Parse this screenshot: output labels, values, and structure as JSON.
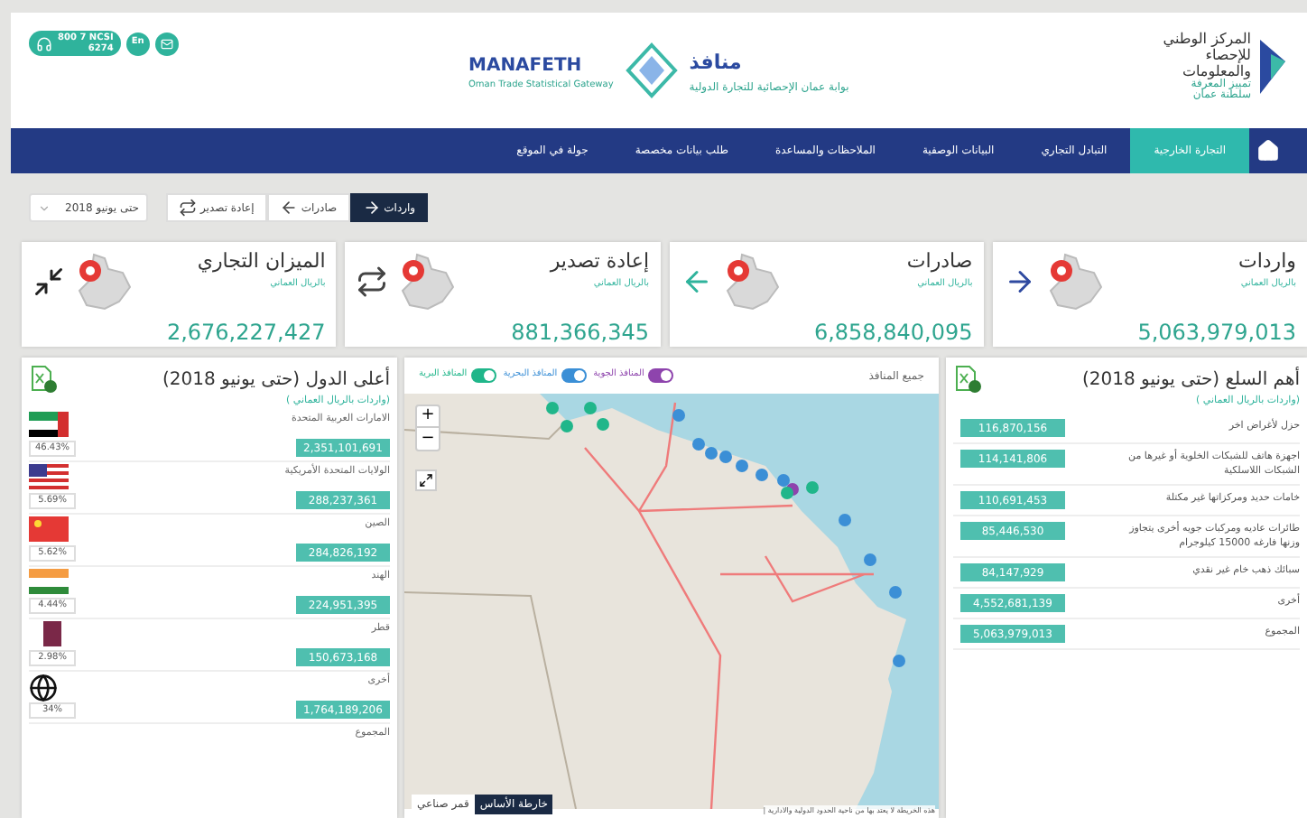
{
  "header": {
    "phone": "800 7 NCSI",
    "phone_sub": "6274",
    "language": "En",
    "portal_name_ar": "منافذ",
    "portal_desc_ar": "بوابة عمان الإحصائية للتجارة الدولية",
    "portal_name_en": "MANAFETH",
    "portal_desc_en": "Oman Trade Statistical Gateway",
    "org_name": "المركز الوطني للإحصاء والمعلومات",
    "org_tagline": "تمييز المعرفة",
    "org_country": "سلطنة عمان"
  },
  "nav": [
    {
      "label": "التجارة الخارجية",
      "selected": true
    },
    {
      "label": "التبادل التجاري",
      "selected": false
    },
    {
      "label": "البيانات الوصفية",
      "selected": false
    },
    {
      "label": "الملاحظات والمساعدة",
      "selected": false
    },
    {
      "label": "طلب بيانات مخصصة",
      "selected": false
    },
    {
      "label": "جولة في الموقع",
      "selected": false
    }
  ],
  "toolbar": {
    "period": "حتى يونيو 2018",
    "flows": [
      {
        "label": "واردات",
        "kind": "right",
        "selected": true
      },
      {
        "label": "صادرات",
        "kind": "left",
        "selected": false
      },
      {
        "label": "إعادة تصدير",
        "kind": "repeat",
        "selected": false
      }
    ]
  },
  "cards": [
    {
      "title": "واردات",
      "subtitle": "بالريال العماني",
      "value": "5,063,979,013",
      "kind": "import"
    },
    {
      "title": "صادرات",
      "subtitle": "بالريال العماني",
      "value": "6,858,840,095",
      "kind": "export"
    },
    {
      "title": "إعادة تصدير",
      "subtitle": "بالريال العماني",
      "value": "881,366,345",
      "kind": "reexport"
    },
    {
      "title": "الميزان التجاري",
      "subtitle": "بالريال العماني",
      "value": "2,676,227,427",
      "kind": "balance"
    }
  ],
  "commodities": {
    "title": "أهم السلع (حتى يونيو 2018)",
    "subtitle": "(واردات بالريال العماني )",
    "rows": [
      {
        "name": "حزل لأغراض اخر",
        "value": "116,870,156"
      },
      {
        "name": "اجهزة هاتف للشبكات الخلوية أو غيرها من الشبكات اللاسلكية",
        "value": "114,141,806"
      },
      {
        "name": "خامات حديد ومركزاتها غير مكتلة",
        "value": "110,691,453"
      },
      {
        "name": "طائرات عاديه ومركبات جويه أخرى يتجاوز وزنها فارغه 15000 كيلوجرام",
        "value": "85,446,530"
      },
      {
        "name": "سبائك ذهب خام غير نقدي",
        "value": "84,147,929"
      },
      {
        "name": "أخرى",
        "value": "4,552,681,139"
      },
      {
        "name": "المجموع",
        "value": "5,063,979,013"
      }
    ]
  },
  "map": {
    "filter_label": "جميع المنافذ",
    "toggles": [
      {
        "label": "المنافذ الجوية",
        "on": true,
        "color": "#8e44ad"
      },
      {
        "label": "المنافذ البحرية",
        "on": true,
        "color": "#3b8fd6"
      },
      {
        "label": "المنافذ البرية",
        "on": true,
        "color": "#20b68a"
      }
    ],
    "zoom_in": "+",
    "zoom_out": "−",
    "basemaps": [
      {
        "label": "خارطة الأساس",
        "selected": true
      },
      {
        "label": "قمر صناعي",
        "selected": false
      }
    ],
    "attribution": "هذه الخريطة لا يعتد بها من ناحية الحدود الدولية والادارية |"
  },
  "countries": {
    "title": "أعلى الدول (حتى يونيو 2018)",
    "subtitle": "(واردات بالريال العماني )",
    "rows": [
      {
        "name": "الامارات العربية المتحدة",
        "kind": "uae",
        "share": "46.43%",
        "value": "2,351,101,691"
      },
      {
        "name": "الولايات المتحدة الأمريكية",
        "kind": "usa",
        "share": "5.69%",
        "value": "288,237,361"
      },
      {
        "name": "الصين",
        "kind": "china",
        "share": "5.62%",
        "value": "284,826,192"
      },
      {
        "name": "الهند",
        "kind": "india",
        "share": "4.44%",
        "value": "224,951,395"
      },
      {
        "name": "قطر",
        "kind": "qatar",
        "share": "2.98%",
        "value": "150,673,168"
      },
      {
        "name": "أخرى",
        "kind": "world",
        "share": "34%",
        "value": "1,764,189,206"
      }
    ],
    "total_label": "المجموع"
  }
}
